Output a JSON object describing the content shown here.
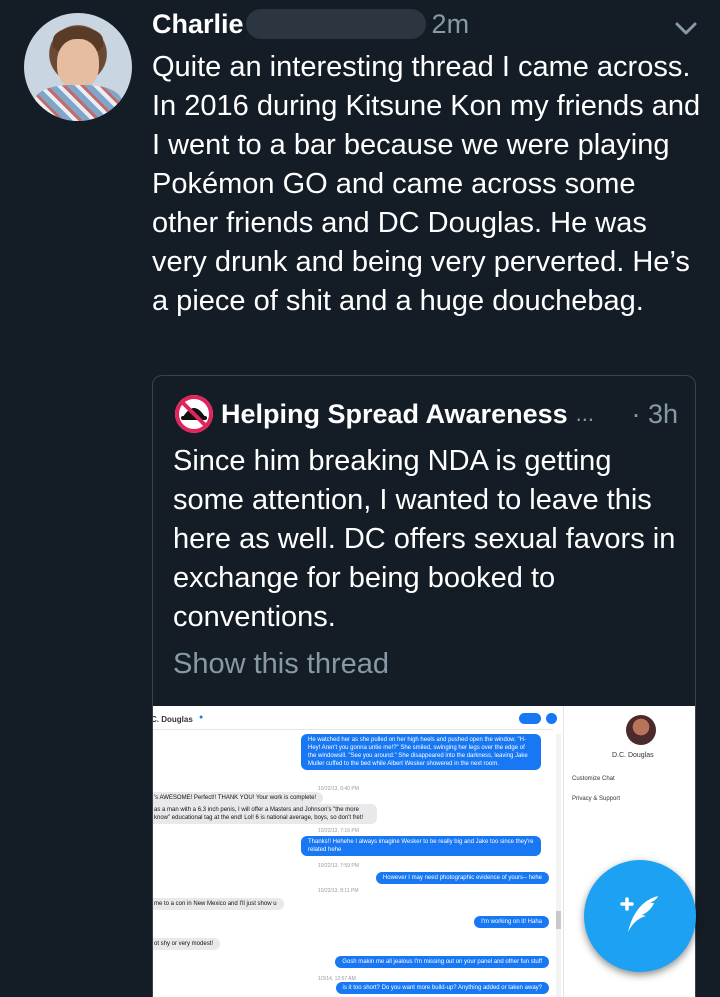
{
  "tweet": {
    "author": "Charlie",
    "time": "2m",
    "text": "Quite an interesting thread I came across. In 2016 during Kitsune Kon my friends and I went to a bar because we were playing Pokémon GO and came across some other friends and DC Douglas. He was very drunk and being very perverted. He’s a piece of shit and a huge douchebag."
  },
  "quoted": {
    "author": "Helping Spread Awareness",
    "ellipsis": "...",
    "time": "· 3h",
    "text": "Since him breaking NDA is getting some attention, I wanted to leave this here as well. DC offers sexual favors in exchange for being booked to conventions.",
    "show_thread": "Show this thread"
  },
  "screenshot": {
    "contact": "C. Douglas",
    "side_name": "D.C. Douglas",
    "menu": [
      "Customize Chat",
      "Privacy & Support"
    ],
    "messages": [
      {
        "side": "right",
        "text": "He watched her as she pulled on her high heels and pushed open the window. \"H-Hey! Aren't you gonna untie me!?\" She smiled, swinging her legs over the edge of the windowsill. \"See you around.\" She disappeared into the darkness, leaving Jake Muller cuffed to the bed while Albert Wesker showered in the next room."
      },
      {
        "side": "ts",
        "text": "10/22/13, 6:40 PM"
      },
      {
        "side": "left",
        "text": "'s AWESOME! Perfect!! THANK YOU! Your work is complete!"
      },
      {
        "side": "left",
        "text": "as a man with a 6.3 inch penis, I will offer a Masters and Johnson's \"the more know\" educational tag at the end! Lol! 6 is national average, boys, so don't fret!"
      },
      {
        "side": "ts",
        "text": "10/22/13, 7:16 PM"
      },
      {
        "side": "right",
        "text": "Thanks!! Hehehe I always imagine Wesker to be really big and Jake too since they're related hehe"
      },
      {
        "side": "ts",
        "text": "10/22/13, 7:59 PM"
      },
      {
        "side": "right",
        "text": "However I may need photographic evidence of yours-- hehe"
      },
      {
        "side": "ts",
        "text": "10/22/13, 8:11 PM"
      },
      {
        "side": "left",
        "text": "me to a con in New Mexico and I'll just show u"
      },
      {
        "side": "right",
        "text": "I'm working on it! Haha"
      },
      {
        "side": "left",
        "text": "ot shy or very modest!"
      },
      {
        "side": "right",
        "text": "Gosh makin me all jealous I'm missing out on your panel and other fun stuff"
      },
      {
        "side": "ts",
        "text": "1/3/14, 12:57 AM"
      },
      {
        "side": "right",
        "text": "is it too short? Do you want more build-up? Anything added or taken away?"
      }
    ]
  },
  "icons": [
    "chevron-down-icon",
    "no-entry-hat-icon",
    "compose-tweet-icon"
  ],
  "colors": {
    "background": "#141d26",
    "accent": "#1da1f2",
    "muted": "#8899a6"
  }
}
